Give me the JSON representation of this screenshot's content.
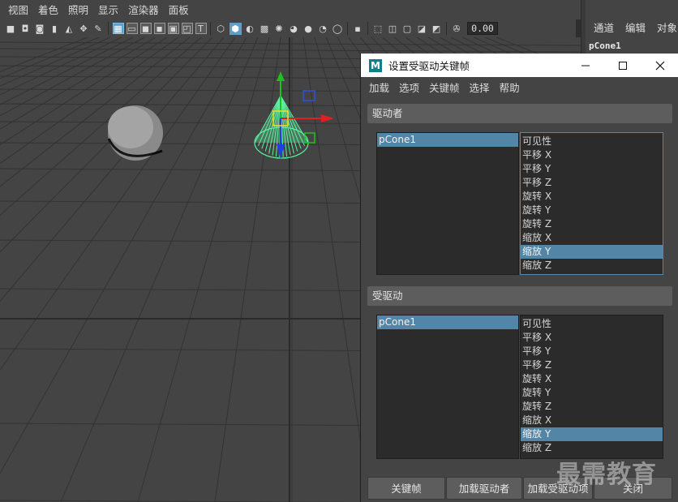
{
  "panel_menu": [
    "视图",
    "着色",
    "照明",
    "显示",
    "渲染器",
    "面板"
  ],
  "toolbar": {
    "icons": [
      "camera-icon",
      "camera-lock-icon",
      "camera-attr-icon",
      "bookmark-icon",
      "image-plane-icon",
      "camera-pan-icon",
      "grease-pencil-icon",
      "grid-icon",
      "film-gate-icon",
      "resolution-gate-icon",
      "gate-mask-icon",
      "field-chart-icon",
      "safe-action-icon",
      "safe-title-icon",
      "wireframe-icon",
      "smooth-shade-icon",
      "default-material-icon",
      "textured-icon",
      "lights-icon",
      "shadows-icon",
      "ambient-occlusion-icon",
      "motion-blur-icon",
      "anti-alias-icon",
      "depth-of-field-icon",
      "isolate-select-icon",
      "xray-icon",
      "xray-joints-icon",
      "xray-active-icon",
      "backface-icon",
      "exposure-icon"
    ],
    "exposure_value": "0.00"
  },
  "channel_box": {
    "menus": [
      "通道",
      "编辑",
      "对象"
    ],
    "object_name": "pCone1"
  },
  "dialog": {
    "title": "设置受驱动关键帧",
    "app_icon_letter": "M",
    "menus": [
      "加载",
      "选项",
      "关键帧",
      "选择",
      "帮助"
    ],
    "driver": {
      "header": "驱动者",
      "objects": [
        "pCone1"
      ],
      "attributes": [
        "可见性",
        "平移 X",
        "平移 Y",
        "平移 Z",
        "旋转 X",
        "旋转 Y",
        "旋转 Z",
        "缩放 X",
        "缩放 Y",
        "缩放 Z"
      ],
      "selected_attribute_index": 8
    },
    "driven": {
      "header": "受驱动",
      "objects": [
        "pCone1"
      ],
      "attributes": [
        "可见性",
        "平移 X",
        "平移 Y",
        "平移 Z",
        "旋转 X",
        "旋转 Y",
        "旋转 Z",
        "缩放 X",
        "缩放 Y",
        "缩放 Z"
      ],
      "selected_attribute_index": 8
    },
    "buttons": {
      "key": "关键帧",
      "load_driver": "加载驱动者",
      "load_driven": "加载受驱动项",
      "close": "关闭"
    }
  },
  "watermark": "最需教育",
  "colors": {
    "selection": "#5285a6",
    "manip_x": "#e02020",
    "manip_y": "#20c020",
    "manip_z": "#2040e0",
    "cone_wire": "#5cf0a0"
  }
}
